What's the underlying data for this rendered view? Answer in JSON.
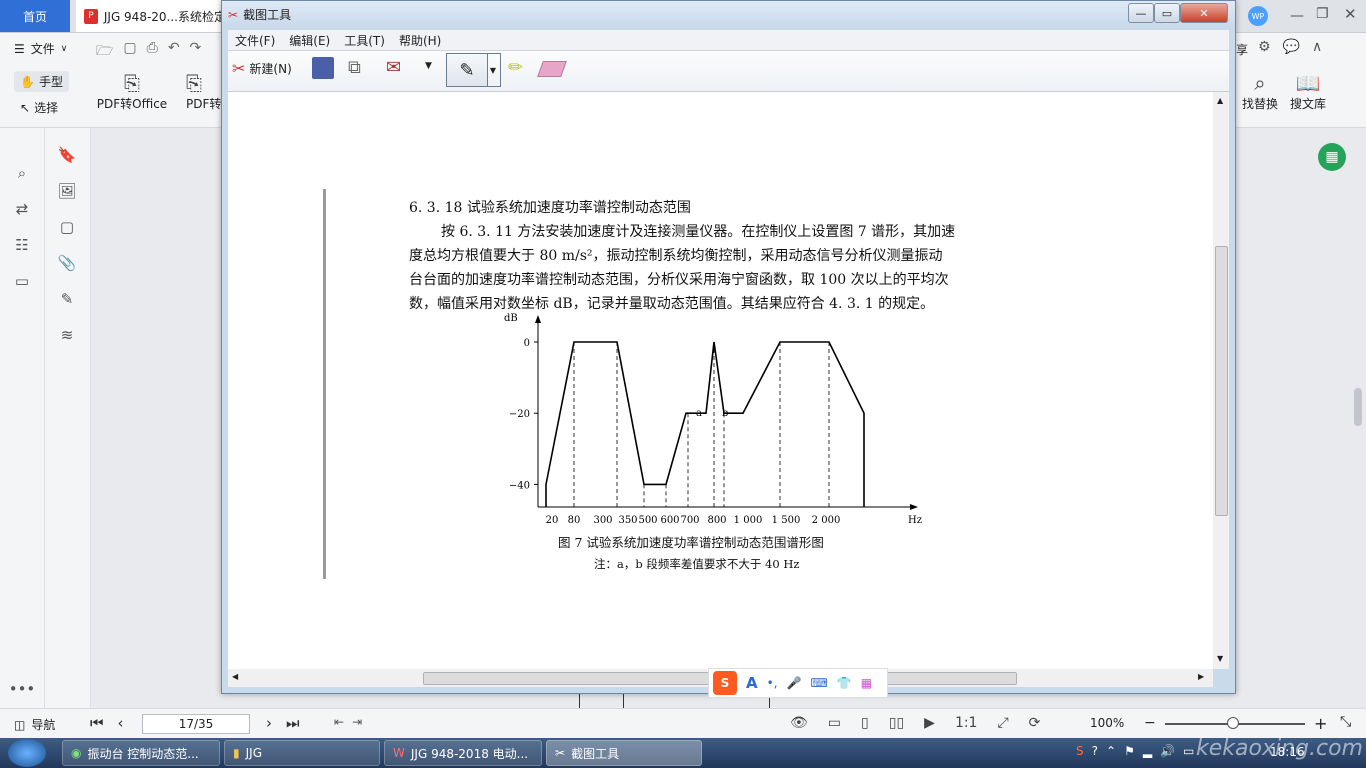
{
  "tabs": {
    "home": "首页",
    "doc": "JJG 948-20...系统检定"
  },
  "wps_menu": {
    "file": "文件"
  },
  "wps_right": {
    "share": "享"
  },
  "ribbon": {
    "hand": "手型",
    "select": "选择",
    "pdf_office": "PDF转Office",
    "pdf_cut": "PDF转",
    "find_replace": "找替换",
    "search_lib": "搜文库"
  },
  "snip": {
    "title": "截图工具",
    "menus": [
      "文件(F)",
      "编辑(E)",
      "工具(T)",
      "帮助(H)"
    ],
    "new_label": "新建(N)"
  },
  "doc": {
    "heading": "6. 3. 18    试验系统加速度功率谱控制动态范围",
    "line1": "按 6. 3. 11 方法安装加速度计及连接测量仪器。在控制仪上设置图 7 谱形，其加速",
    "line2": "度总均方根值要大于 80 m/s²，振动控制系统均衡控制，采用动态信号分析仪测量振动",
    "line3": "台台面的加速度功率谱控制动态范围，分析仪采用海宁窗函数，取 100 次以上的平均次",
    "line4": "数，幅值采用对数坐标 dB，记录并量取动态范围值。其结果应符合 4. 3. 1 的规定。",
    "caption": "图 7    试验系统加速度功率谱控制动态范围谱形图",
    "note": "注：a，b 段频率差值要求不大于 40 Hz"
  },
  "chart_data": {
    "type": "line",
    "ylabel": "dB",
    "xlabel": "Hz",
    "y_ticks": [
      "0",
      "-20",
      "-40"
    ],
    "x_ticks": [
      "20",
      "80",
      "300",
      "350",
      "500",
      "600",
      "700",
      "800",
      "1 000",
      "1 500",
      "2 000"
    ],
    "x_ticks_note": "350 500 and 600700 printed close together",
    "segment_labels": [
      "a",
      "b"
    ],
    "series": [
      {
        "x": [
          "20",
          "20",
          "80",
          "300",
          "350",
          "500",
          "600",
          "700",
          "750",
          "800",
          "850",
          "1 000",
          "1 500",
          "2 000",
          "2 300",
          "2 300"
        ],
        "y": [
          -45,
          -40,
          0,
          0,
          -40,
          -40,
          -20,
          -20,
          -20,
          0,
          -20,
          -20,
          0,
          0,
          -20,
          -45
        ]
      }
    ],
    "ylim": [
      -45,
      5
    ]
  },
  "wps_status": {
    "nav": "导航",
    "page": "17/35",
    "zoom": "100%"
  },
  "taskbar": {
    "items": [
      "振动台 控制动态范...",
      "JJG",
      "JJG 948-2018 电动...",
      "截图工具"
    ],
    "time": "18:16",
    "watermark": "kekaoxing.com"
  },
  "ime": {
    "brand": "S",
    "items": [
      "A",
      "•,",
      "🎤",
      "⌨",
      "👕",
      "▦"
    ]
  }
}
